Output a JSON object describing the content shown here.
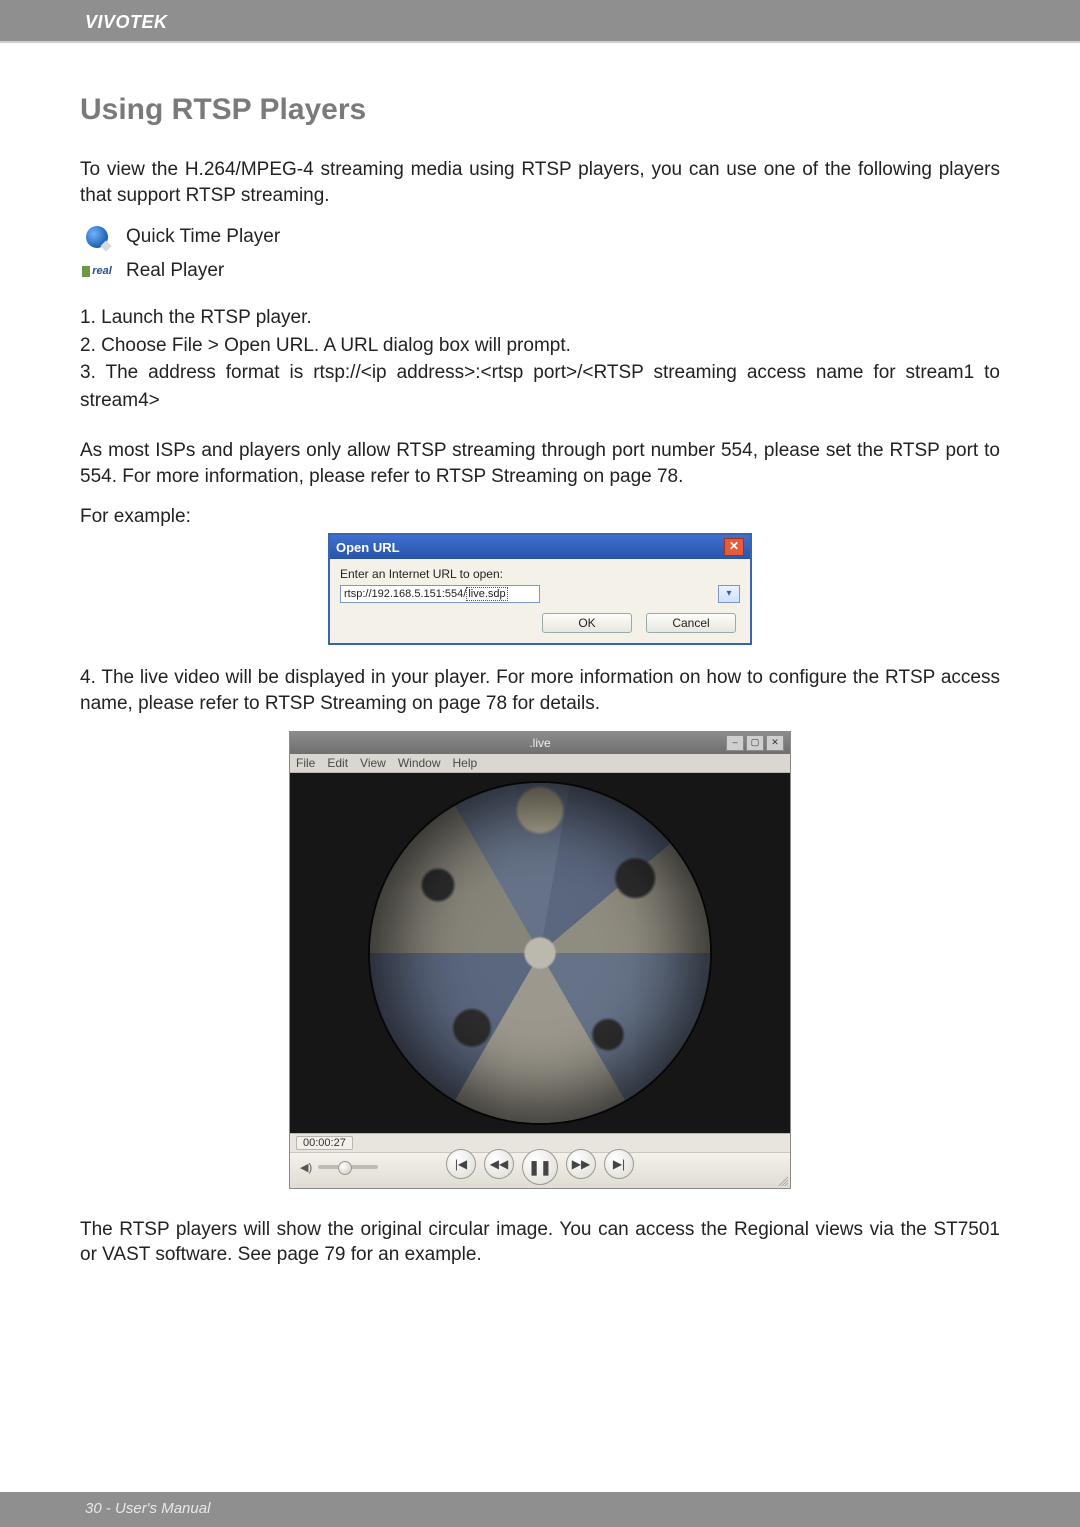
{
  "header": {
    "brand": "VIVOTEK"
  },
  "title": "Using RTSP Players",
  "intro": "To view the H.264/MPEG-4 streaming media using RTSP players, you can use one of the following players that support RTSP streaming.",
  "players": {
    "quicktime": "Quick Time Player",
    "real": "Real Player",
    "real_icon_text": "real"
  },
  "steps": {
    "s1": "1. Launch the RTSP player.",
    "s2": "2. Choose File > Open URL. A URL dialog box will prompt.",
    "s3": "3. The address format is rtsp://<ip address>:<rtsp port>/<RTSP streaming access name for stream1 to stream4>"
  },
  "note": "As most ISPs and players only allow RTSP streaming through port number 554, please set the RTSP port to 554. For more information, please refer to RTSP Streaming on page 78.",
  "for_example": "For example:",
  "open_url_dialog": {
    "title": "Open URL",
    "close_glyph": "✕",
    "label": "Enter an Internet URL to open:",
    "value_prefix": "rtsp://192.168.5.151:554/",
    "value_highlight": "live.sdp",
    "dropdown_glyph": "▾",
    "ok": "OK",
    "cancel": "Cancel"
  },
  "step4": "4. The live video will be displayed in your player. For more information on how to configure the RTSP access name, please refer to RTSP Streaming on page 78 for details.",
  "player_window": {
    "title": ".live",
    "menubar": {
      "file": "File",
      "edit": "Edit",
      "view": "View",
      "window": "Window",
      "help": "Help"
    },
    "win_buttons": {
      "min": "–",
      "max": "▢",
      "close": "✕"
    },
    "time": "00:00:27",
    "volume_icon": "◀)",
    "transport": {
      "prev": "|◀",
      "rew": "◀◀",
      "pause": "❚❚",
      "fwd": "▶▶",
      "next": "▶|"
    }
  },
  "closing": "The RTSP players will show the original circular image. You can access the Regional views via the ST7501 or VAST software. See page 79 for an example.",
  "footer": "30 - User's Manual"
}
